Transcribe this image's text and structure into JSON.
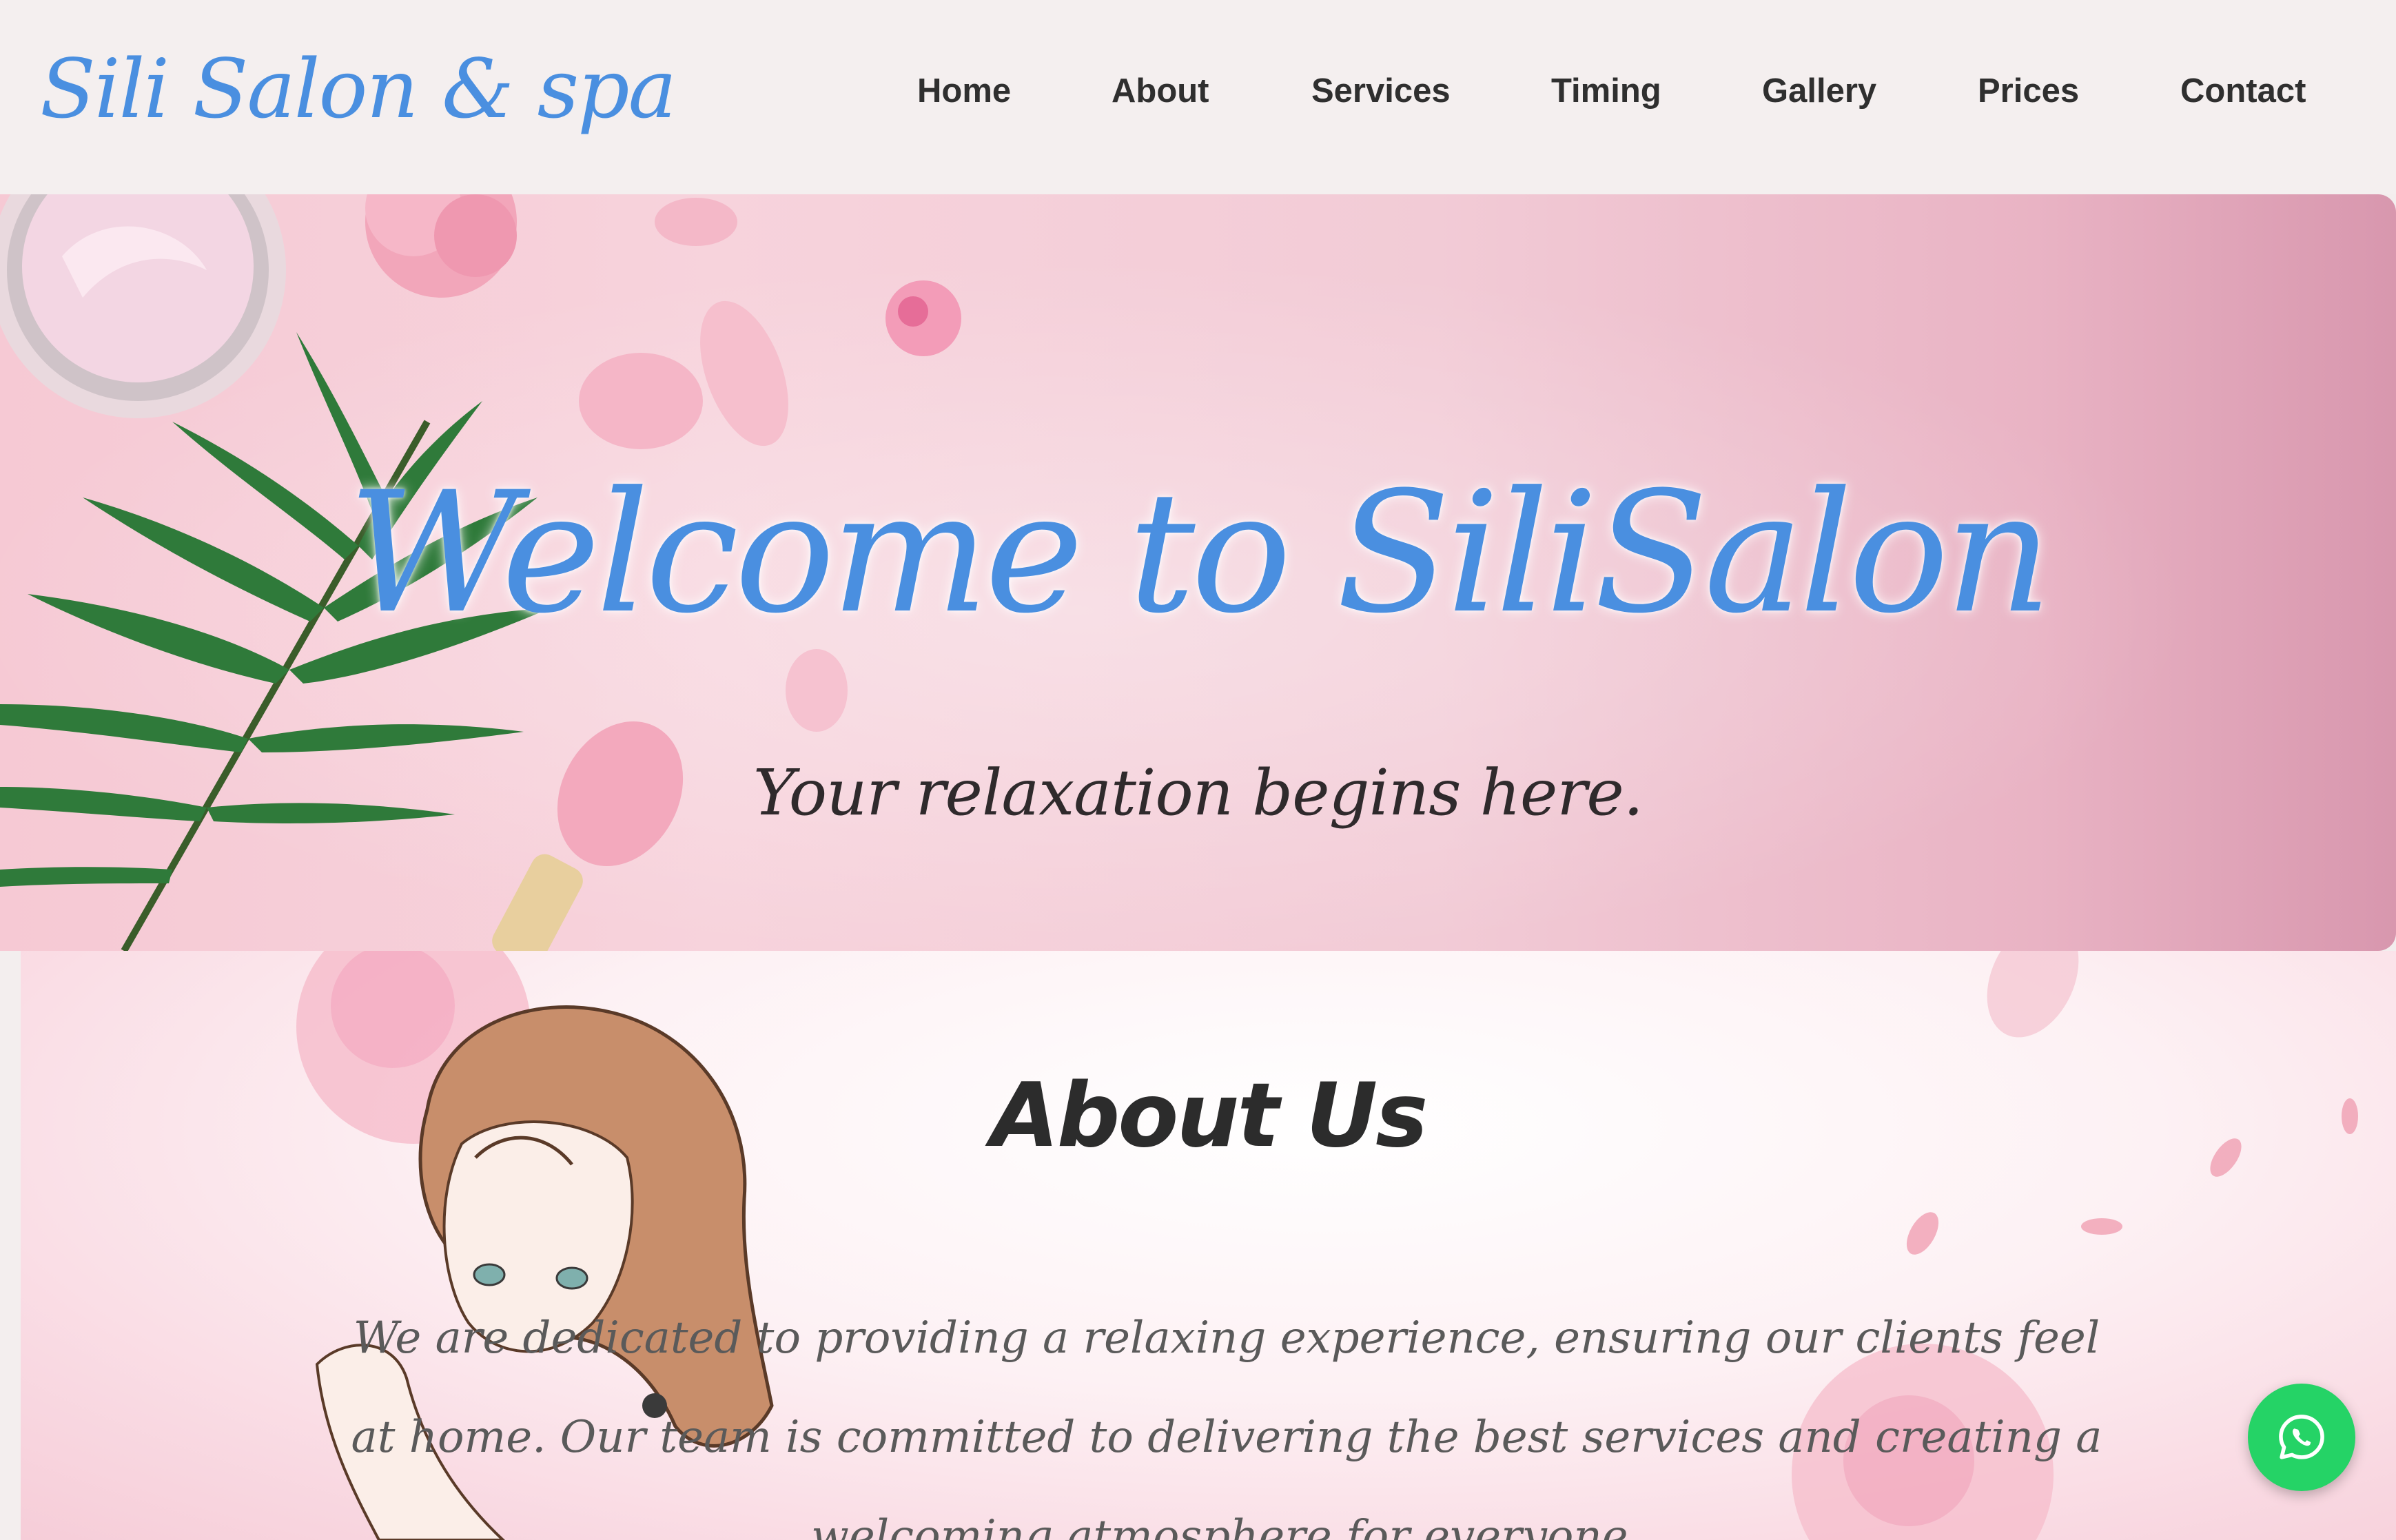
{
  "header": {
    "logo": "Sili Salon & spa",
    "nav": [
      "Home",
      "About",
      "Services",
      "Timing",
      "Gallery",
      "Prices",
      "Contact"
    ]
  },
  "hero": {
    "title": "Welcome to SiliSalon",
    "subtitle": "Your relaxation begins here."
  },
  "about": {
    "title": "About Us",
    "text": "We are dedicated to providing a relaxing experience, ensuring our clients feel at home. Our team is committed to delivering the best services and creating a welcoming atmosphere for everyone."
  },
  "floating": {
    "whatsapp_icon": "whatsapp-icon"
  },
  "colors": {
    "brand_blue": "#4a8fe0",
    "whatsapp_green": "#25d366",
    "hero_pink": "#f6c9d4"
  }
}
